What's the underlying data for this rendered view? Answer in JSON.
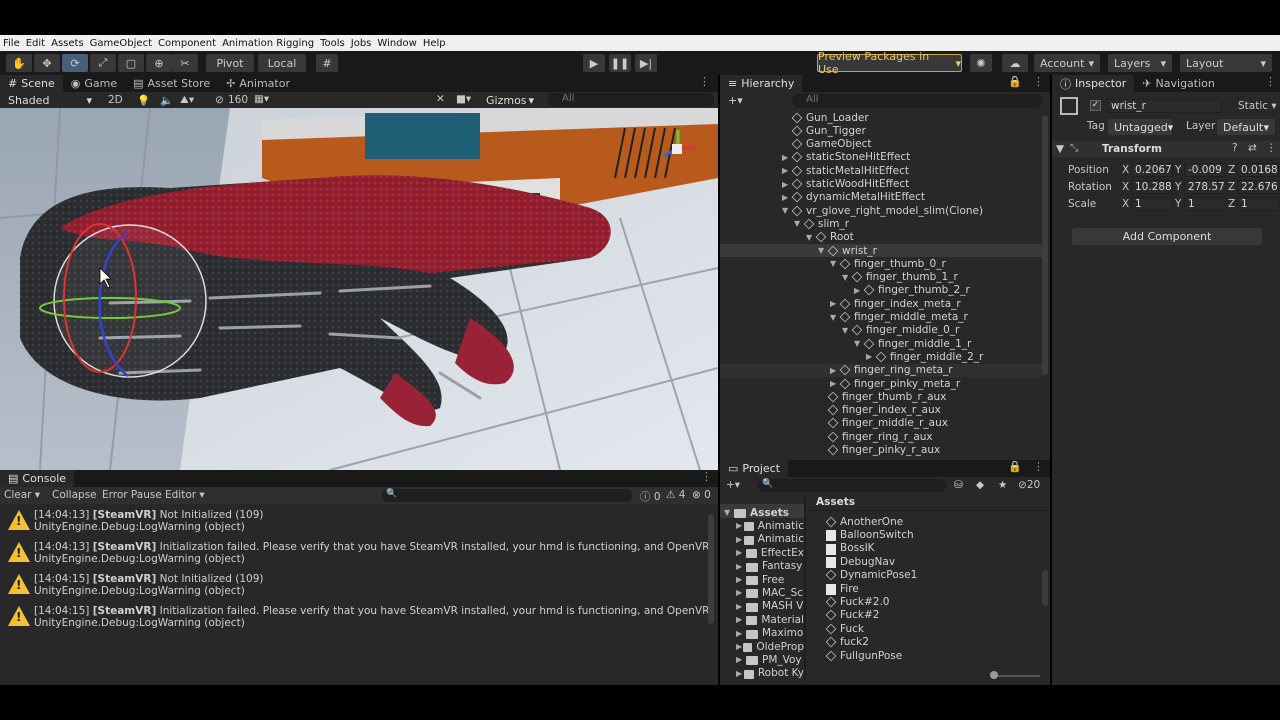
{
  "menu": [
    "File",
    "Edit",
    "Assets",
    "GameObject",
    "Component",
    "Animation Rigging",
    "Tools",
    "Jobs",
    "Window",
    "Help"
  ],
  "toolbar": {
    "pivot": "Pivot",
    "local": "Local",
    "preview": "Preview Packages in Use",
    "account": "Account",
    "layers": "Layers",
    "layout": "Layout"
  },
  "scene_tabs": [
    "Scene",
    "Game",
    "Asset Store",
    "Animator"
  ],
  "scene_toolbar": {
    "shading": "Shaded",
    "mode2d": "2D",
    "vis_count": "160",
    "gizmos": "Gizmos",
    "search": "All"
  },
  "hierarchy": {
    "title": "Hierarchy",
    "search": "All",
    "rows": [
      {
        "label": "Gun_Loader",
        "depth": 0,
        "fold": ""
      },
      {
        "label": "Gun_Tigger",
        "depth": 0,
        "fold": ""
      },
      {
        "label": "GameObject",
        "depth": 0,
        "fold": ""
      },
      {
        "label": "staticStoneHitEffect",
        "depth": 0,
        "fold": "▶"
      },
      {
        "label": "staticMetalHitEffect",
        "depth": 0,
        "fold": "▶"
      },
      {
        "label": "staticWoodHitEffect",
        "depth": 0,
        "fold": "▶"
      },
      {
        "label": "dynamicMetalHitEffect",
        "depth": 0,
        "fold": "▶"
      },
      {
        "label": "vr_glove_right_model_slim(Clone)",
        "depth": 0,
        "fold": "▼"
      },
      {
        "label": "slim_r",
        "depth": 1,
        "fold": "▼"
      },
      {
        "label": "Root",
        "depth": 2,
        "fold": "▼"
      },
      {
        "label": "wrist_r",
        "depth": 3,
        "fold": "▼"
      },
      {
        "label": "finger_thumb_0_r",
        "depth": 4,
        "fold": "▼"
      },
      {
        "label": "finger_thumb_1_r",
        "depth": 5,
        "fold": "▼"
      },
      {
        "label": "finger_thumb_2_r",
        "depth": 6,
        "fold": "▶"
      },
      {
        "label": "finger_index_meta_r",
        "depth": 4,
        "fold": "▶"
      },
      {
        "label": "finger_middle_meta_r",
        "depth": 4,
        "fold": "▼"
      },
      {
        "label": "finger_middle_0_r",
        "depth": 5,
        "fold": "▼"
      },
      {
        "label": "finger_middle_1_r",
        "depth": 6,
        "fold": "▼"
      },
      {
        "label": "finger_middle_2_r",
        "depth": 7,
        "fold": "▶"
      },
      {
        "label": "finger_ring_meta_r",
        "depth": 4,
        "fold": "▶"
      },
      {
        "label": "finger_pinky_meta_r",
        "depth": 4,
        "fold": "▶"
      },
      {
        "label": "finger_thumb_r_aux",
        "depth": 3,
        "fold": ""
      },
      {
        "label": "finger_index_r_aux",
        "depth": 3,
        "fold": ""
      },
      {
        "label": "finger_middle_r_aux",
        "depth": 3,
        "fold": ""
      },
      {
        "label": "finger_ring_r_aux",
        "depth": 3,
        "fold": ""
      },
      {
        "label": "finger_pinky_r_aux",
        "depth": 3,
        "fold": ""
      }
    ]
  },
  "inspector": {
    "tabs": [
      "Inspector",
      "Navigation"
    ],
    "name": "wrist_r",
    "static": "Static",
    "tag_label": "Tag",
    "tag": "Untagged",
    "layer_label": "Layer",
    "layer": "Default",
    "transform": "Transform",
    "position_label": "Position",
    "rotation_label": "Rotation",
    "scale_label": "Scale",
    "position": {
      "x": "0.2067",
      "y": "-0.009",
      "z": "0.0168"
    },
    "rotation": {
      "x": "10.288",
      "y": "278.575",
      "z": "22.676"
    },
    "scale": {
      "x": "1",
      "y": "1",
      "z": "1"
    },
    "add_component": "Add Component"
  },
  "console": {
    "title": "Console",
    "clear": "Clear",
    "collapse": "Collapse",
    "error_pause": "Error Pause",
    "editor": "Editor",
    "count_info": "0",
    "count_warn": "4",
    "count_err": "0",
    "lines": [
      {
        "time": "[14:04:13]",
        "tag": "[SteamVR]",
        "msg": "Not Initialized (109)",
        "sub": "UnityEngine.Debug:LogWarning (object)"
      },
      {
        "time": "[14:04:13]",
        "tag": "[SteamVR]",
        "msg": "Initialization failed. Please verify that you have SteamVR installed, your hmd is functioning, and OpenVR Loader is chec",
        "sub": "UnityEngine.Debug:LogWarning (object)"
      },
      {
        "time": "[14:04:15]",
        "tag": "[SteamVR]",
        "msg": "Not Initialized (109)",
        "sub": "UnityEngine.Debug:LogWarning (object)"
      },
      {
        "time": "[14:04:15]",
        "tag": "[SteamVR]",
        "msg": "Initialization failed. Please verify that you have SteamVR installed, your hmd is functioning, and OpenVR Loader is chec",
        "sub": "UnityEngine.Debug:LogWarning (object)"
      }
    ]
  },
  "project": {
    "title": "Project",
    "count": "20",
    "assets_label": "Assets",
    "folders": [
      "Assets",
      "Animatic",
      "Animatic",
      "EffectEx",
      "Fantasy",
      "Free",
      "MAC_Sc",
      "MASH V",
      "Material",
      "Maximo",
      "OldeProp",
      "PM_Voy",
      "Robot Ky"
    ],
    "files": [
      "AnotherOne",
      "BalloonSwitch",
      "BossIK",
      "DebugNav",
      "DynamicPose1",
      "Fire",
      "Fuck#2.0",
      "Fuck#2",
      "Fuck",
      "fuck2",
      "FullgunPose"
    ]
  },
  "colors": {
    "accent": "#46607c",
    "warning": "#f2c230",
    "preview_border": "#c8a040"
  }
}
